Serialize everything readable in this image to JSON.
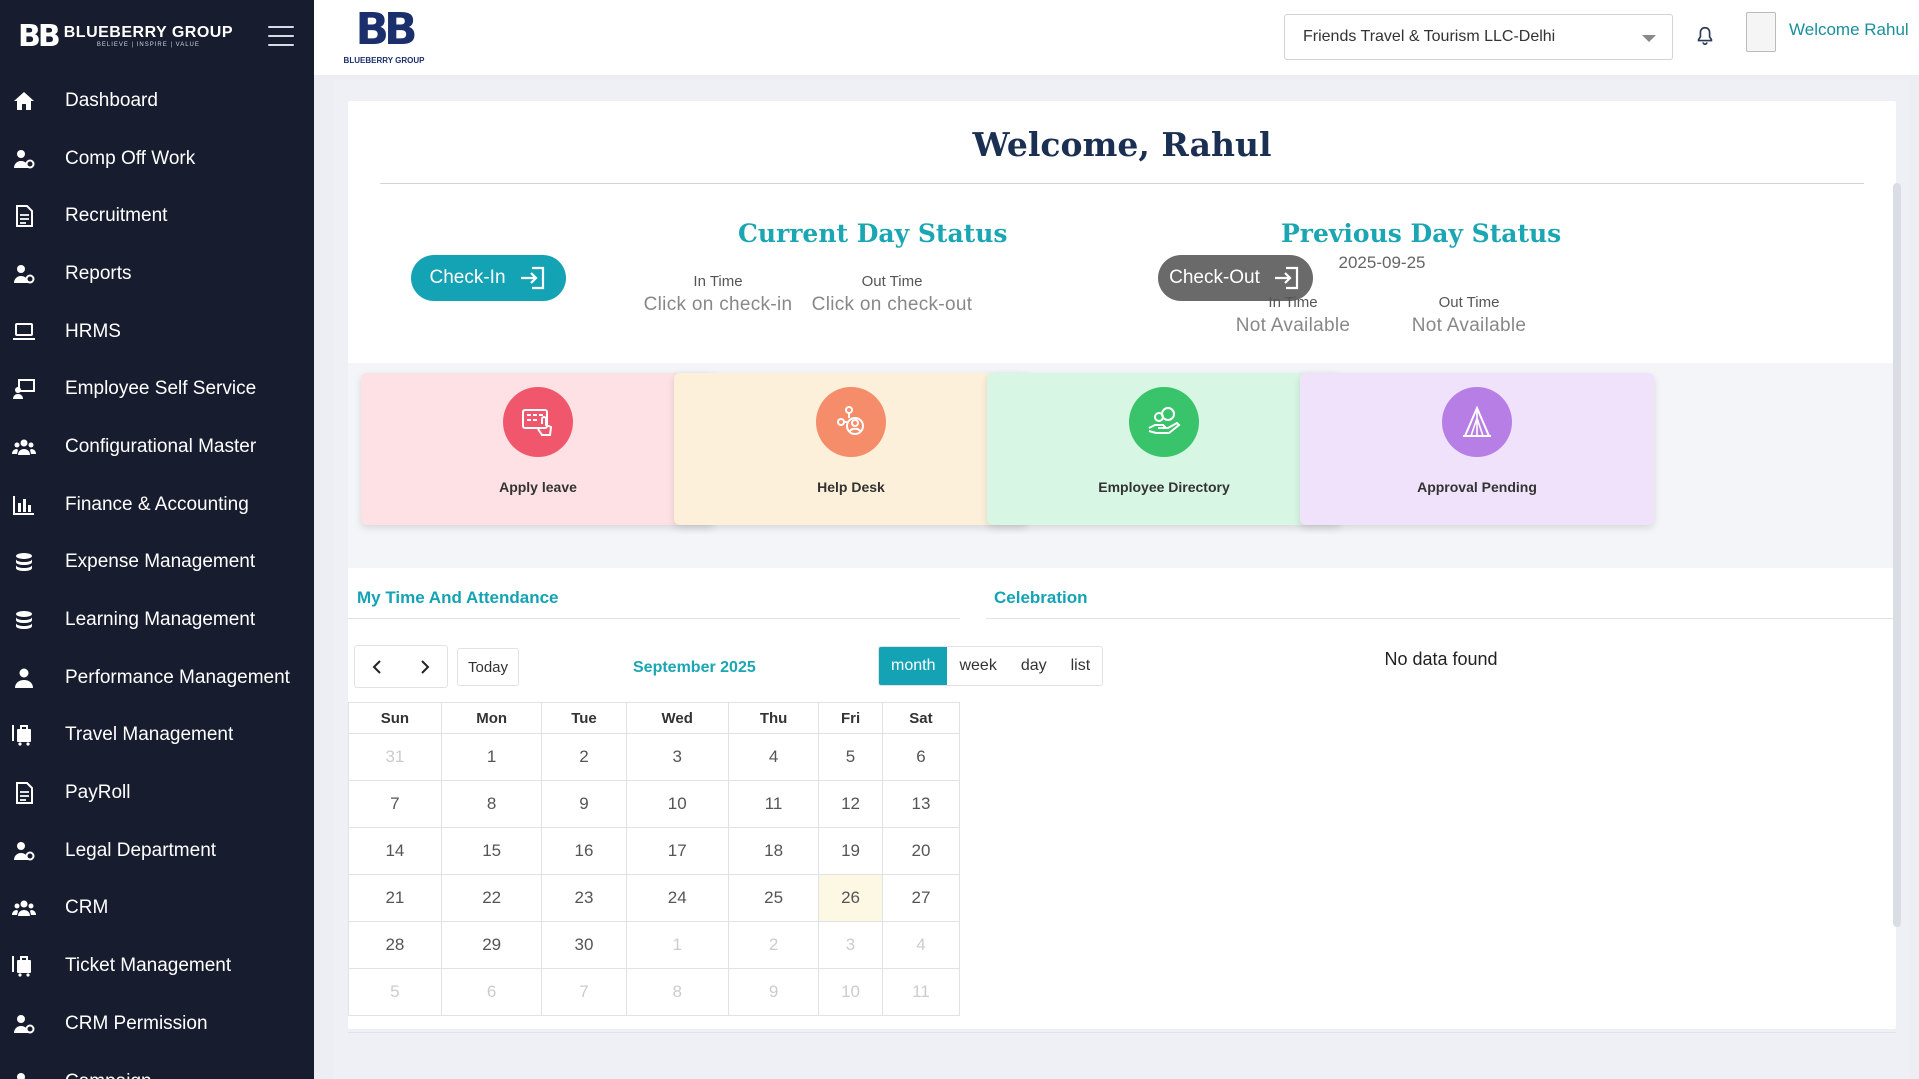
{
  "sidebar": {
    "brand": {
      "mark": "BB",
      "name": "BLUEBERRY GROUP",
      "tagline": "BELIEVE | INSPIRE | VALUE"
    },
    "items": [
      {
        "label": "Dashboard",
        "icon": "home-icon"
      },
      {
        "label": "Comp Off Work",
        "icon": "users-cog-icon"
      },
      {
        "label": "Recruitment",
        "icon": "document-icon"
      },
      {
        "label": "Reports",
        "icon": "users-cog-icon"
      },
      {
        "label": "HRMS",
        "icon": "laptop-icon"
      },
      {
        "label": "Employee Self Service",
        "icon": "presenter-icon"
      },
      {
        "label": "Configurational Master",
        "icon": "users-group-icon"
      },
      {
        "label": "Finance & Accounting",
        "icon": "chart-icon"
      },
      {
        "label": "Expense Management",
        "icon": "coins-icon"
      },
      {
        "label": "Learning Management",
        "icon": "coins-icon"
      },
      {
        "label": "Performance Management",
        "icon": "user-tie-icon"
      },
      {
        "label": "Travel Management",
        "icon": "luggage-icon"
      },
      {
        "label": "PayRoll",
        "icon": "document-icon"
      },
      {
        "label": "Legal Department",
        "icon": "users-cog-icon"
      },
      {
        "label": "CRM",
        "icon": "users-group-icon"
      },
      {
        "label": "Ticket Management",
        "icon": "luggage-icon"
      },
      {
        "label": "CRM Permission",
        "icon": "users-cog-icon"
      },
      {
        "label": "Campaign",
        "icon": "users-cog-icon"
      }
    ]
  },
  "topbar": {
    "logo_mark": "BB",
    "logo_sub": "BLUEBERRY GROUP",
    "company": "Friends Travel & Tourism LLC-Delhi",
    "welcome": "Welcome Rahul"
  },
  "main": {
    "welcome_title": "Welcome, Rahul",
    "current_status": {
      "title": "Current Day Status",
      "checkin_label": "Check-In",
      "checkout_label": "Check-Out",
      "in_time_label": "In Time",
      "in_time_value": "Click on check-in",
      "out_time_label": "Out Time",
      "out_time_value": "Click on check-out"
    },
    "previous_status": {
      "title": "Previous Day Status",
      "date": "2025-09-25",
      "in_time_label": "In Time",
      "in_time_value": "Not Available",
      "out_time_label": "Out Time",
      "out_time_value": "Not Available"
    },
    "tiles": [
      {
        "label": "Apply leave",
        "icon": "calendar-hand-icon",
        "bg": "#fde1e4",
        "circle": "#f0576d"
      },
      {
        "label": "Help Desk",
        "icon": "network-user-icon",
        "bg": "#fdf0da",
        "circle": "#f58c6a"
      },
      {
        "label": "Employee Directory",
        "icon": "hand-money-icon",
        "bg": "#d7f6e4",
        "circle": "#39c46b"
      },
      {
        "label": "Approval Pending",
        "icon": "pyramid-icon",
        "bg": "#f0e2fb",
        "circle": "#b77ee6"
      }
    ],
    "attendance": {
      "title": "My Time And Attendance",
      "today_label": "Today",
      "month_title": "September 2025",
      "views": [
        "month",
        "week",
        "day",
        "list"
      ],
      "active_view": "month",
      "weekdays": [
        "Sun",
        "Mon",
        "Tue",
        "Wed",
        "Thu",
        "Fri",
        "Sat"
      ],
      "weeks": [
        [
          {
            "d": "31",
            "o": true
          },
          {
            "d": "1"
          },
          {
            "d": "2"
          },
          {
            "d": "3"
          },
          {
            "d": "4"
          },
          {
            "d": "5"
          },
          {
            "d": "6"
          }
        ],
        [
          {
            "d": "7"
          },
          {
            "d": "8"
          },
          {
            "d": "9"
          },
          {
            "d": "10"
          },
          {
            "d": "11"
          },
          {
            "d": "12"
          },
          {
            "d": "13"
          }
        ],
        [
          {
            "d": "14"
          },
          {
            "d": "15"
          },
          {
            "d": "16"
          },
          {
            "d": "17"
          },
          {
            "d": "18"
          },
          {
            "d": "19"
          },
          {
            "d": "20"
          }
        ],
        [
          {
            "d": "21"
          },
          {
            "d": "22"
          },
          {
            "d": "23"
          },
          {
            "d": "24"
          },
          {
            "d": "25"
          },
          {
            "d": "26",
            "t": true
          },
          {
            "d": "27"
          }
        ],
        [
          {
            "d": "28"
          },
          {
            "d": "29"
          },
          {
            "d": "30"
          },
          {
            "d": "1",
            "o": true
          },
          {
            "d": "2",
            "o": true
          },
          {
            "d": "3",
            "o": true
          },
          {
            "d": "4",
            "o": true
          }
        ],
        [
          {
            "d": "5",
            "o": true
          },
          {
            "d": "6",
            "o": true
          },
          {
            "d": "7",
            "o": true
          },
          {
            "d": "8",
            "o": true
          },
          {
            "d": "9",
            "o": true
          },
          {
            "d": "10",
            "o": true
          },
          {
            "d": "11",
            "o": true
          }
        ]
      ]
    },
    "celebration": {
      "title": "Celebration",
      "empty": "No data found"
    }
  }
}
